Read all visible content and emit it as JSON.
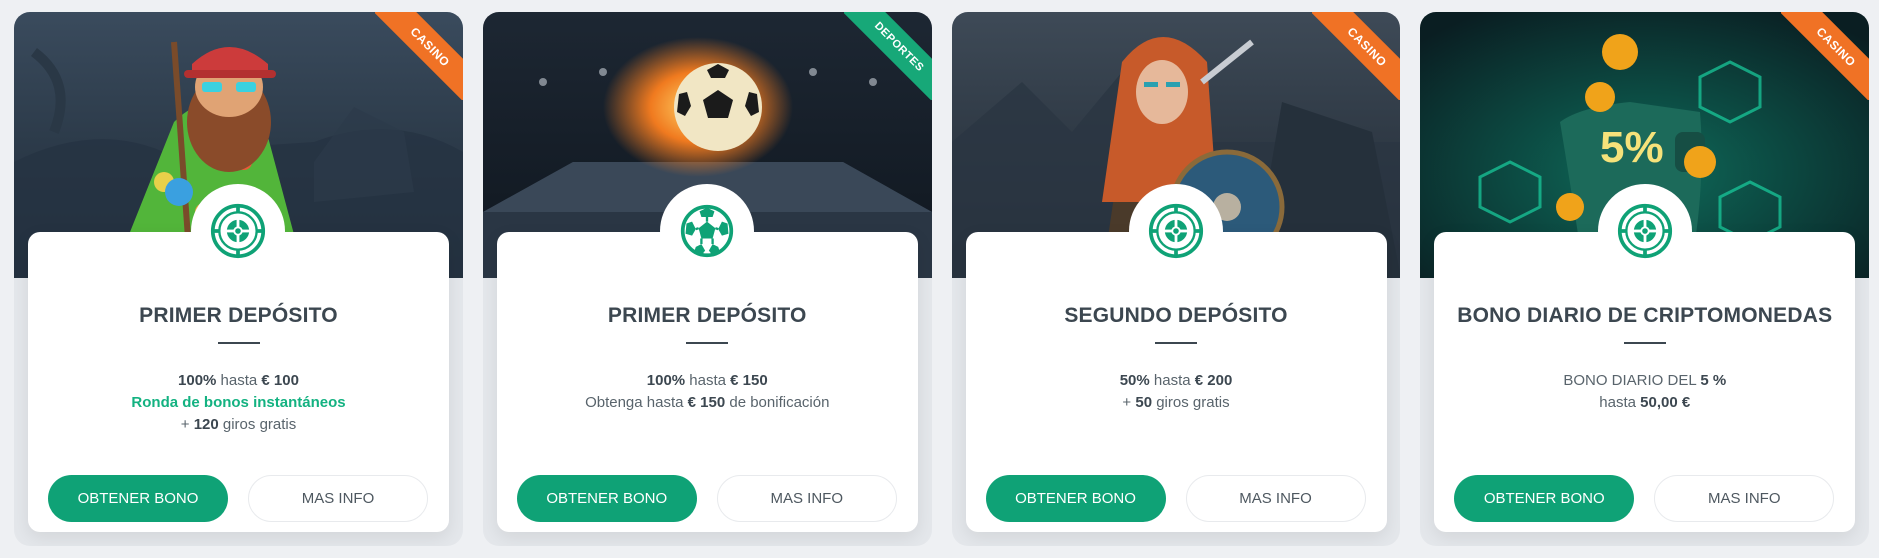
{
  "colors": {
    "accent": "#0fa276",
    "casino_ribbon": "#f07225",
    "deportes_ribbon": "#17a878"
  },
  "cards": [
    {
      "ribbon": "CASINO",
      "icon": "roulette-icon",
      "title": "PRIMER DEPÓSITO",
      "line1": {
        "a": "100%",
        "b": " hasta ",
        "c": "€ 100"
      },
      "line2": "Ronda de bonos instantáneos",
      "line3": {
        "a": "+ ",
        "b": "120",
        "c": " giros gratis"
      },
      "cta": "OBTENER BONO",
      "info": "MAS INFO"
    },
    {
      "ribbon": "DEPORTES",
      "icon": "soccer-ball-icon",
      "title": "PRIMER DEPÓSITO",
      "line1": {
        "a": "100%",
        "b": " hasta ",
        "c": "€ 150"
      },
      "line2": {
        "a": "Obtenga hasta ",
        "b": "€ 150",
        "c": " de bonificación"
      },
      "cta": "OBTENER BONO",
      "info": "MAS INFO"
    },
    {
      "ribbon": "CASINO",
      "icon": "roulette-icon",
      "title": "SEGUNDO DEPÓSITO",
      "line1": {
        "a": "50%",
        "b": " hasta ",
        "c": "€ 200"
      },
      "line2": {
        "a": "+ ",
        "b": "50",
        "c": " giros gratis"
      },
      "cta": "OBTENER BONO",
      "info": "MAS INFO"
    },
    {
      "ribbon": "CASINO",
      "icon": "roulette-icon",
      "title": "BONO DIARIO DE CRIPTOMONEDAS",
      "line1": {
        "a": "BONO DIARIO DEL ",
        "b": "5 %"
      },
      "line2": {
        "a": "hasta ",
        "b": "50,00 €"
      },
      "hero_text": "5%",
      "cta": "OBTENER BONO",
      "info": "MAS INFO"
    }
  ]
}
